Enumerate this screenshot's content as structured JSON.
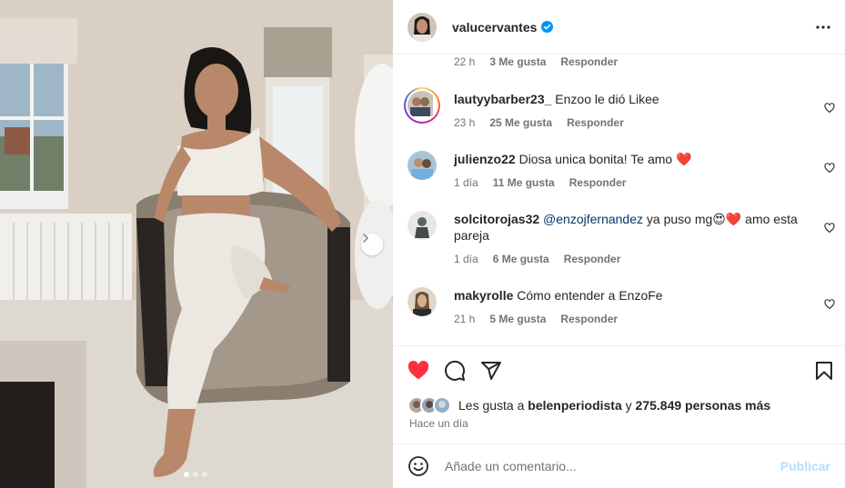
{
  "post": {
    "author": "valucervantes",
    "verified": true,
    "carousel": {
      "slides": 3,
      "active_slide": 1
    }
  },
  "top_comment_meta": {
    "time": "22 h",
    "likes": "3 Me gusta",
    "reply": "Responder"
  },
  "comments": [
    {
      "user": "lautyybarber23_",
      "text": "Enzoo le dió Likee",
      "time": "23 h",
      "likes": "25 Me gusta",
      "reply": "Responder"
    },
    {
      "user": "julienzo22",
      "text": "Diosa unica bonita! Te amo ❤️",
      "time": "1 día",
      "likes": "11 Me gusta",
      "reply": "Responder"
    },
    {
      "user": "solcitorojas32",
      "mention": "@enzojfernandez",
      "text": " ya puso mg😍❤️ amo esta pareja",
      "time": "1 día",
      "likes": "6 Me gusta",
      "reply": "Responder"
    },
    {
      "user": "makyrolle",
      "text": "Cómo entender a EnzoFe",
      "time": "21 h",
      "likes": "5 Me gusta",
      "reply": "Responder"
    }
  ],
  "likes": {
    "prefix": "Les gusta a ",
    "first_user": "belenperiodista",
    "middle": " y ",
    "count": "275.849 personas más"
  },
  "posted_ago": "Hace un día",
  "add_comment": {
    "placeholder": "Añade un comentario...",
    "post_label": "Publicar"
  },
  "colors": {
    "like_red": "#ff3040",
    "verified_blue": "#0095f6",
    "post_disabled": "#b2dffc",
    "meta_gray": "#737373"
  },
  "icons": [
    "more-horizontal-icon",
    "heart-icon",
    "comment-icon",
    "share-icon",
    "bookmark-icon",
    "emoji-icon",
    "chevron-right-icon",
    "verified-badge-icon"
  ]
}
